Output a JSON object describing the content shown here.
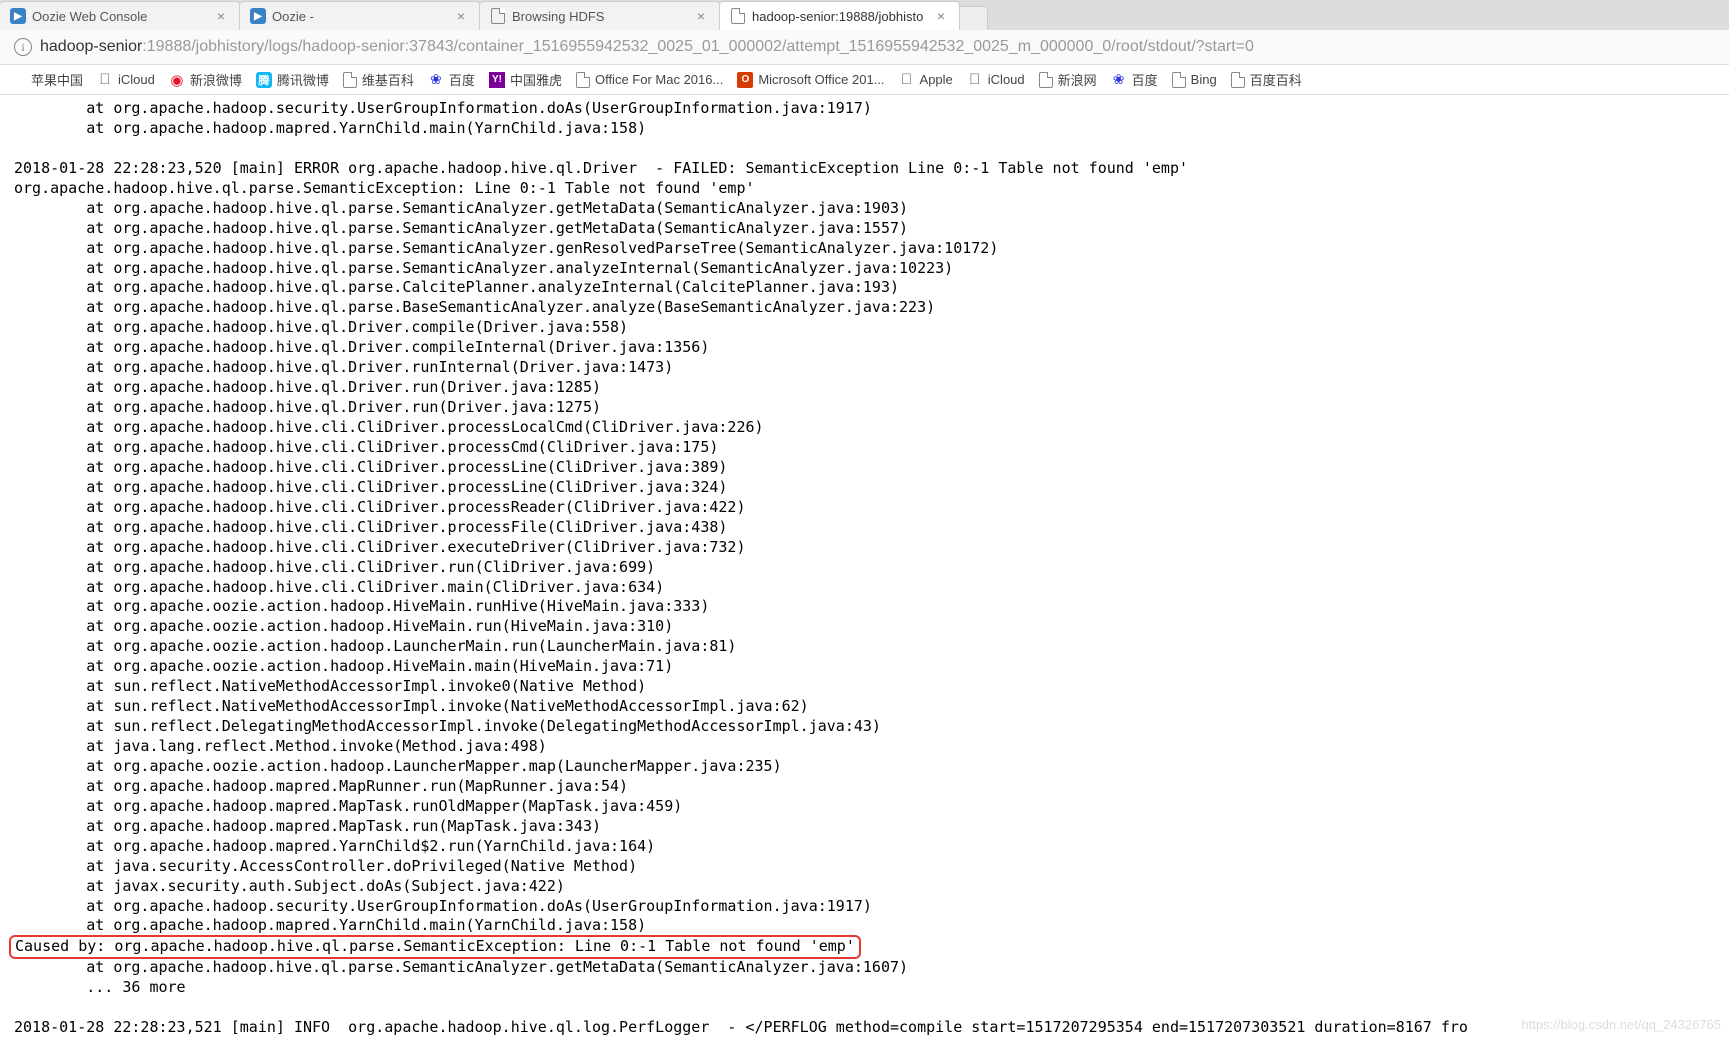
{
  "tabs": [
    {
      "title": "Oozie Web Console",
      "icon": "oozie"
    },
    {
      "title": "Oozie -",
      "icon": "oozie"
    },
    {
      "title": "Browsing HDFS",
      "icon": "file"
    },
    {
      "title": "hadoop-senior:19888/jobhisto",
      "icon": "file",
      "active": true
    }
  ],
  "url": {
    "host": "hadoop-senior",
    "rest": ":19888/jobhistory/logs/hadoop-senior:37843/container_1516955942532_0025_01_000002/attempt_1516955942532_0025_m_000000_0/root/stdout/?start=0"
  },
  "bookmarks": [
    {
      "label": "苹果中国",
      "icon": "none"
    },
    {
      "label": "iCloud",
      "icon": "apple"
    },
    {
      "label": "新浪微博",
      "icon": "weibo"
    },
    {
      "label": "腾讯微博",
      "icon": "tencent"
    },
    {
      "label": "维基百科",
      "icon": "file"
    },
    {
      "label": "百度",
      "icon": "baidu"
    },
    {
      "label": "中国雅虎",
      "icon": "yahoo"
    },
    {
      "label": "Office For Mac 2016...",
      "icon": "file"
    },
    {
      "label": "Microsoft Office 201...",
      "icon": "msoffice"
    },
    {
      "label": "Apple",
      "icon": "apple"
    },
    {
      "label": "iCloud",
      "icon": "apple"
    },
    {
      "label": "新浪网",
      "icon": "file"
    },
    {
      "label": "百度",
      "icon": "baidu"
    },
    {
      "label": "Bing",
      "icon": "file"
    },
    {
      "label": "百度百科",
      "icon": "file"
    }
  ],
  "log": {
    "lines_before": [
      "        at org.apache.hadoop.security.UserGroupInformation.doAs(UserGroupInformation.java:1917)",
      "        at org.apache.hadoop.mapred.YarnChild.main(YarnChild.java:158)",
      "",
      "2018-01-28 22:28:23,520 [main] ERROR org.apache.hadoop.hive.ql.Driver  - FAILED: SemanticException Line 0:-1 Table not found 'emp'",
      "org.apache.hadoop.hive.ql.parse.SemanticException: Line 0:-1 Table not found 'emp'",
      "        at org.apache.hadoop.hive.ql.parse.SemanticAnalyzer.getMetaData(SemanticAnalyzer.java:1903)",
      "        at org.apache.hadoop.hive.ql.parse.SemanticAnalyzer.getMetaData(SemanticAnalyzer.java:1557)",
      "        at org.apache.hadoop.hive.ql.parse.SemanticAnalyzer.genResolvedParseTree(SemanticAnalyzer.java:10172)",
      "        at org.apache.hadoop.hive.ql.parse.SemanticAnalyzer.analyzeInternal(SemanticAnalyzer.java:10223)",
      "        at org.apache.hadoop.hive.ql.parse.CalcitePlanner.analyzeInternal(CalcitePlanner.java:193)",
      "        at org.apache.hadoop.hive.ql.parse.BaseSemanticAnalyzer.analyze(BaseSemanticAnalyzer.java:223)",
      "        at org.apache.hadoop.hive.ql.Driver.compile(Driver.java:558)",
      "        at org.apache.hadoop.hive.ql.Driver.compileInternal(Driver.java:1356)",
      "        at org.apache.hadoop.hive.ql.Driver.runInternal(Driver.java:1473)",
      "        at org.apache.hadoop.hive.ql.Driver.run(Driver.java:1285)",
      "        at org.apache.hadoop.hive.ql.Driver.run(Driver.java:1275)",
      "        at org.apache.hadoop.hive.cli.CliDriver.processLocalCmd(CliDriver.java:226)",
      "        at org.apache.hadoop.hive.cli.CliDriver.processCmd(CliDriver.java:175)",
      "        at org.apache.hadoop.hive.cli.CliDriver.processLine(CliDriver.java:389)",
      "        at org.apache.hadoop.hive.cli.CliDriver.processLine(CliDriver.java:324)",
      "        at org.apache.hadoop.hive.cli.CliDriver.processReader(CliDriver.java:422)",
      "        at org.apache.hadoop.hive.cli.CliDriver.processFile(CliDriver.java:438)",
      "        at org.apache.hadoop.hive.cli.CliDriver.executeDriver(CliDriver.java:732)",
      "        at org.apache.hadoop.hive.cli.CliDriver.run(CliDriver.java:699)",
      "        at org.apache.hadoop.hive.cli.CliDriver.main(CliDriver.java:634)",
      "        at org.apache.oozie.action.hadoop.HiveMain.runHive(HiveMain.java:333)",
      "        at org.apache.oozie.action.hadoop.HiveMain.run(HiveMain.java:310)",
      "        at org.apache.oozie.action.hadoop.LauncherMain.run(LauncherMain.java:81)",
      "        at org.apache.oozie.action.hadoop.HiveMain.main(HiveMain.java:71)",
      "        at sun.reflect.NativeMethodAccessorImpl.invoke0(Native Method)",
      "        at sun.reflect.NativeMethodAccessorImpl.invoke(NativeMethodAccessorImpl.java:62)",
      "        at sun.reflect.DelegatingMethodAccessorImpl.invoke(DelegatingMethodAccessorImpl.java:43)",
      "        at java.lang.reflect.Method.invoke(Method.java:498)",
      "        at org.apache.oozie.action.hadoop.LauncherMapper.map(LauncherMapper.java:235)",
      "        at org.apache.hadoop.mapred.MapRunner.run(MapRunner.java:54)",
      "        at org.apache.hadoop.mapred.MapTask.runOldMapper(MapTask.java:459)",
      "        at org.apache.hadoop.mapred.MapTask.run(MapTask.java:343)",
      "        at org.apache.hadoop.mapred.YarnChild$2.run(YarnChild.java:164)",
      "        at java.security.AccessController.doPrivileged(Native Method)",
      "        at javax.security.auth.Subject.doAs(Subject.java:422)",
      "        at org.apache.hadoop.security.UserGroupInformation.doAs(UserGroupInformation.java:1917)",
      "        at org.apache.hadoop.mapred.YarnChild.main(YarnChild.java:158)"
    ],
    "highlighted": "Caused by: org.apache.hadoop.hive.ql.parse.SemanticException: Line 0:-1 Table not found 'emp'",
    "lines_after": [
      "        at org.apache.hadoop.hive.ql.parse.SemanticAnalyzer.getMetaData(SemanticAnalyzer.java:1607)",
      "        ... 36 more",
      "",
      "2018-01-28 22:28:23,521 [main] INFO  org.apache.hadoop.hive.ql.log.PerfLogger  - </PERFLOG method=compile start=1517207295354 end=1517207303521 duration=8167 fro"
    ]
  },
  "watermark": "https://blog.csdn.net/qq_24326765"
}
